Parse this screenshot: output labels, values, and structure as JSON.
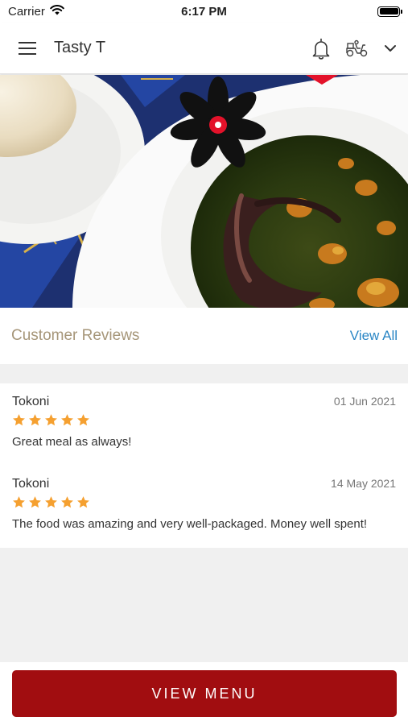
{
  "status_bar": {
    "carrier": "Carrier",
    "time": "6:17 PM"
  },
  "header": {
    "title": "Tasty T"
  },
  "reviews": {
    "title": "Customer Reviews",
    "view_all_label": "View All",
    "items": [
      {
        "name": "Tokoni",
        "date": "01 Jun 2021",
        "rating": 5,
        "text": "Great meal as always!"
      },
      {
        "name": "Tokoni",
        "date": "14 May 2021",
        "rating": 5,
        "text": "The food was amazing and very well-packaged. Money well spent!"
      }
    ]
  },
  "footer": {
    "button_label": "VIEW MENU"
  },
  "colors": {
    "accent": "#a10d10",
    "link": "#2a86c5",
    "star": "#f5a030",
    "section_title": "#a69679"
  },
  "icons": [
    "wifi-icon",
    "battery-icon",
    "hamburger-menu-icon",
    "bell-icon",
    "delivery-scooter-icon",
    "chevron-down-icon",
    "star-icon"
  ]
}
